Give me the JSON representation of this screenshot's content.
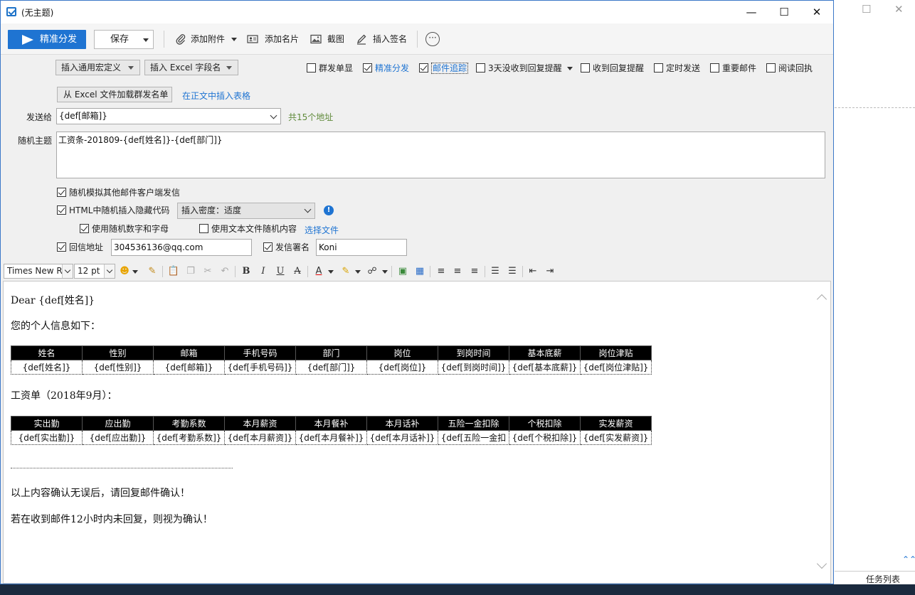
{
  "window": {
    "title": "(无主题)"
  },
  "toolbar": {
    "send_label": "精准分发",
    "save_label": "保存",
    "attach_label": "添加附件",
    "card_label": "添加名片",
    "screenshot_label": "截图",
    "signature_label": "插入签名"
  },
  "options": {
    "macro_label": "插入通用宏定义",
    "excel_field_label": "插入 Excel 字段名",
    "load_excel_label": "从 Excel 文件加载群发名单",
    "insert_table_link": "在正文中插入表格",
    "checks": [
      {
        "label": "群发单显",
        "checked": false
      },
      {
        "label": "精准分发",
        "checked": true
      },
      {
        "label": "邮件追踪",
        "checked": true
      },
      {
        "label": "3天没收到回复提醒",
        "checked": false
      },
      {
        "label": "收到回复提醒",
        "checked": false
      },
      {
        "label": "定时发送",
        "checked": false
      },
      {
        "label": "重要邮件",
        "checked": false
      },
      {
        "label": "阅读回执",
        "checked": false
      }
    ]
  },
  "form": {
    "to_label": "发送给",
    "to_value": "{def[邮箱]}",
    "to_count": "共15个地址",
    "subject_label": "随机主题",
    "subject_value": "工资条-201809-{def[姓名]}-{def[部门]}",
    "random_client_label": "随机模拟其他邮件客户端发信",
    "html_hidden_label": "HTML中随机插入隐藏代码",
    "density_value": "插入密度：适度",
    "use_random_label": "使用随机数字和字母",
    "use_text_file_label": "使用文本文件随机内容",
    "choose_file_link": "选择文件",
    "reply_label": "回信地址",
    "reply_value": "304536136@qq.com",
    "sender_label": "发信署名",
    "sender_value": "Koni"
  },
  "format": {
    "font": "Times New Roman",
    "size": "12 pt"
  },
  "body": {
    "greeting": "Dear {def[姓名]}",
    "intro": "您的个人信息如下：",
    "table1_headers": [
      "姓名",
      "性别",
      "邮箱",
      "手机号码",
      "部门",
      "岗位",
      "到岗时间",
      "基本底薪",
      "岗位津贴"
    ],
    "table1_cells": [
      "{def[姓名]}",
      "{def[性别]}",
      "{def[邮箱]}",
      "{def[手机号码]}",
      "{def[部门]}",
      "{def[岗位]}",
      "{def[到岗时间]}",
      "{def[基本底薪]}",
      "{def[岗位津贴]}"
    ],
    "salary_title": "工资单（2018年9月）：",
    "table2_headers": [
      "实出勤",
      "应出勤",
      "考勤系数",
      "本月薪资",
      "本月餐补",
      "本月话补",
      "五险一金扣除",
      "个税扣除",
      "实发薪资"
    ],
    "table2_cells": [
      "{def[实出勤]}",
      "{def[应出勤]}",
      "{def[考勤系数]}",
      "{def[本月薪资]}",
      "{def[本月餐补]}",
      "{def[本月话补]}",
      "{def[五险一金扣",
      "{def[个税扣除]}",
      "{def[实发薪资]}"
    ],
    "confirm1": "以上内容确认无误后，请回复邮件确认！",
    "confirm2": "若在收到邮件12小时内未回复，则视为确认！"
  },
  "side": {
    "task_list": "任务列表"
  }
}
